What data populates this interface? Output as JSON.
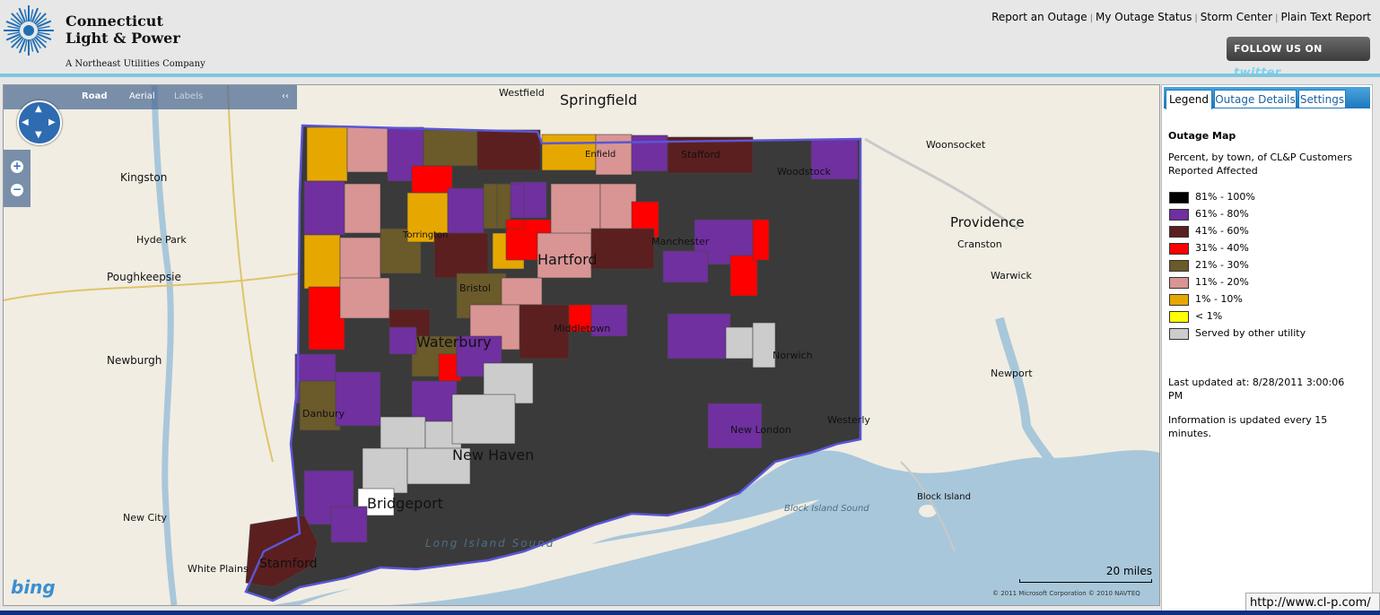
{
  "brand": {
    "line1": "Connecticut",
    "line2": "Light & Power",
    "sub": "A Northeast Utilities Company"
  },
  "topnav": [
    "Report an Outage",
    "My Outage Status",
    "Storm Center",
    "Plain Text Report"
  ],
  "twitter": {
    "prefix": "FOLLOW US ON",
    "brand": "twitter"
  },
  "map_toolbar": {
    "road": "Road",
    "aerial": "Aerial",
    "labels": "Labels"
  },
  "map_labels": {
    "springfield": "Springfield",
    "hartford": "Hartford",
    "waterbury": "Waterbury",
    "new_haven": "New Haven",
    "bridgeport": "Bridgeport",
    "stamford": "Stamford",
    "providence": "Providence",
    "westfield": "Westfield",
    "kingston": "Kingston",
    "poughkeepsie": "Poughkeepsie",
    "newburgh": "Newburgh",
    "woonsocket": "Woonsocket",
    "long_island_sound": "Long Island Sound",
    "new_london": "New London",
    "norwich": "Norwich",
    "middletown": "Middletown",
    "danbury": "Danbury",
    "westerly": "Westerly",
    "block_island": "Block Island",
    "new_city": "New City",
    "white_plains": "White Plains",
    "newport": "Newport",
    "manchester": "Manchester",
    "torrington": "Torrington",
    "bristol": "Bristol",
    "enfield": "Enfield",
    "stafford": "Stafford",
    "woodstock": "Woodstock",
    "hyde_park": "Hyde Park",
    "warwick": "Warwick",
    "cranston": "Cranston",
    "stony_point_text": "Block Island Sound"
  },
  "bing": "bing",
  "copyright": "© 2011 Microsoft Corporation   © 2010 NAVTEQ",
  "scale": "20 miles",
  "tabs": [
    "Legend",
    "Outage Details",
    "Settings"
  ],
  "legend": {
    "title": "Outage Map",
    "desc": "Percent, by town, of CL&P Customers Reported Affected",
    "items": [
      {
        "label": "81% - 100%",
        "color": "#000000"
      },
      {
        "label": "61% - 80%",
        "color": "#7030a0"
      },
      {
        "label": "41% - 60%",
        "color": "#5c1f1f"
      },
      {
        "label": "31% - 40%",
        "color": "#ff0000"
      },
      {
        "label": "21% - 30%",
        "color": "#6b5a2a"
      },
      {
        "label": "11% - 20%",
        "color": "#d99594"
      },
      {
        "label": "1% - 10%",
        "color": "#e6a800"
      },
      {
        "label": "< 1%",
        "color": "#ffff00"
      },
      {
        "label": "Served by other utility",
        "color": "#cccccc"
      }
    ],
    "updated": "Last updated at: 8/28/2011 3:00:06 PM",
    "info": "Information is updated every 15 minutes."
  },
  "url_tip": "http://www.cl-p.com/"
}
